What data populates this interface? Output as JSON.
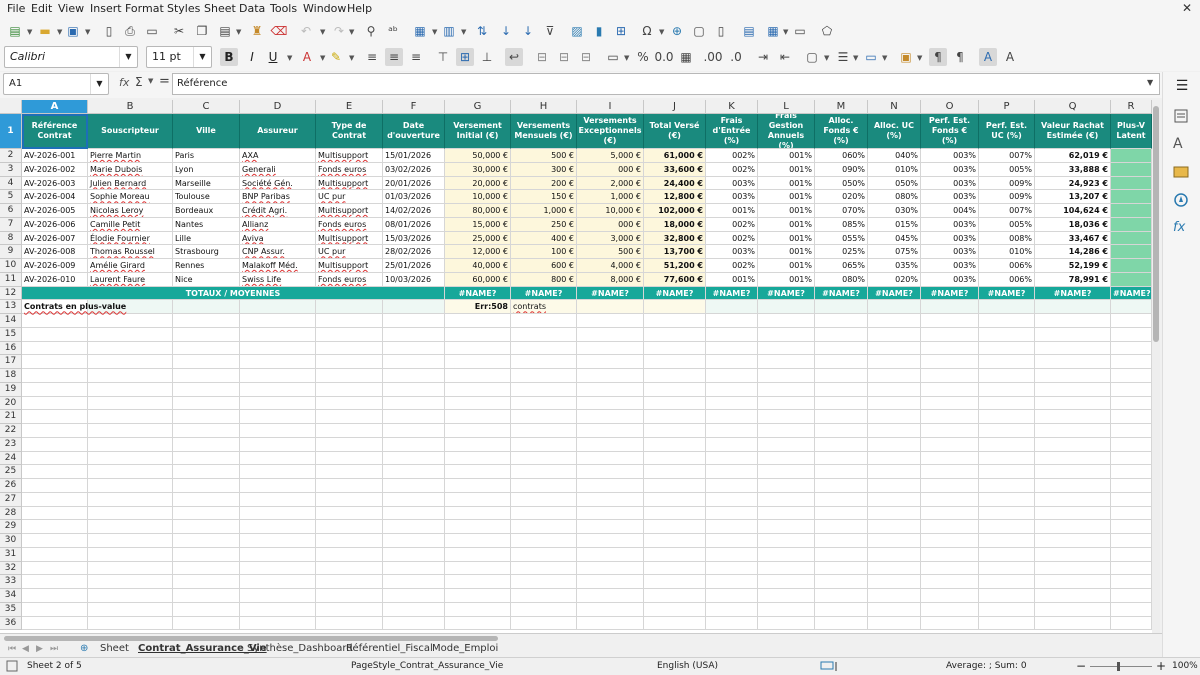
{
  "menu": [
    "File",
    "Edit",
    "View",
    "Insert",
    "Format",
    "Styles",
    "Sheet",
    "Data",
    "Tools",
    "Window",
    "Help"
  ],
  "font": {
    "name": "Calibri",
    "size": "11 pt"
  },
  "namebox": "A1",
  "formula": "Référence",
  "columns": [
    "A",
    "B",
    "C",
    "D",
    "E",
    "F",
    "G",
    "H",
    "I",
    "J",
    "K",
    "L",
    "M",
    "N",
    "O",
    "P",
    "Q",
    "R"
  ],
  "headers": [
    "Référence Contrat",
    "Souscripteur",
    "Ville",
    "Assureur",
    "Type de Contrat",
    "Date d'ouverture",
    "Versement Initial (€)",
    "Versements Mensuels (€)",
    "Versements Exceptionnels (€)",
    "Total Versé (€)",
    "Frais d'Entrée (%)",
    "Frais Gestion Annuels (%)",
    "Alloc. Fonds € (%)",
    "Alloc. UC (%)",
    "Perf. Est. Fonds € (%)",
    "Perf. Est. UC (%)",
    "Valeur Rachat Estimée (€)",
    "Plus-V Latent"
  ],
  "rows": [
    [
      "AV-2026-001",
      "Pierre Martin",
      "Paris",
      "AXA",
      "Multisupport",
      "15/01/2026",
      "50,000 €",
      "500 €",
      "5,000 €",
      "61,000 €",
      "002%",
      "001%",
      "060%",
      "040%",
      "003%",
      "007%",
      "62,019 €"
    ],
    [
      "AV-2026-002",
      "Marie Dubois",
      "Lyon",
      "Generali",
      "Fonds euros",
      "03/02/2026",
      "30,000 €",
      "300 €",
      "000 €",
      "33,600 €",
      "002%",
      "001%",
      "090%",
      "010%",
      "003%",
      "005%",
      "33,888 €"
    ],
    [
      "AV-2026-003",
      "Julien Bernard",
      "Marseille",
      "Société Gén.",
      "Multisupport",
      "20/01/2026",
      "20,000 €",
      "200 €",
      "2,000 €",
      "24,400 €",
      "003%",
      "001%",
      "050%",
      "050%",
      "003%",
      "009%",
      "24,923 €"
    ],
    [
      "AV-2026-004",
      "Sophie Moreau",
      "Toulouse",
      "BNP Paribas",
      "UC pur",
      "01/03/2026",
      "10,000 €",
      "150 €",
      "1,000 €",
      "12,800 €",
      "003%",
      "001%",
      "020%",
      "080%",
      "003%",
      "009%",
      "13,207 €"
    ],
    [
      "AV-2026-005",
      "Nicolas Leroy",
      "Bordeaux",
      "Crédit Agri.",
      "Multisupport",
      "14/02/2026",
      "80,000 €",
      "1,000 €",
      "10,000 €",
      "102,000 €",
      "001%",
      "001%",
      "070%",
      "030%",
      "004%",
      "007%",
      "104,624 €"
    ],
    [
      "AV-2026-006",
      "Camille Petit",
      "Nantes",
      "Allianz",
      "Fonds euros",
      "08/01/2026",
      "15,000 €",
      "250 €",
      "000 €",
      "18,000 €",
      "002%",
      "001%",
      "085%",
      "015%",
      "003%",
      "005%",
      "18,036 €"
    ],
    [
      "AV-2026-007",
      "Élodie Fournier",
      "Lille",
      "Aviva",
      "Multisupport",
      "15/03/2026",
      "25,000 €",
      "400 €",
      "3,000 €",
      "32,800 €",
      "002%",
      "001%",
      "055%",
      "045%",
      "003%",
      "008%",
      "33,467 €"
    ],
    [
      "AV-2026-008",
      "Thomas Roussel",
      "Strasbourg",
      "CNP Assur.",
      "UC pur",
      "28/02/2026",
      "12,000 €",
      "100 €",
      "500 €",
      "13,700 €",
      "003%",
      "001%",
      "025%",
      "075%",
      "003%",
      "010%",
      "14,286 €"
    ],
    [
      "AV-2026-009",
      "Amélie Girard",
      "Rennes",
      "Malakoff Méd.",
      "Multisupport",
      "25/01/2026",
      "40,000 €",
      "600 €",
      "4,000 €",
      "51,200 €",
      "002%",
      "001%",
      "065%",
      "035%",
      "003%",
      "006%",
      "52,199 €"
    ],
    [
      "AV-2026-010",
      "Laurent Faure",
      "Nice",
      "Swiss Life",
      "Fonds euros",
      "10/03/2026",
      "60,000 €",
      "800 €",
      "8,000 €",
      "77,600 €",
      "001%",
      "001%",
      "080%",
      "020%",
      "003%",
      "006%",
      "78,991 €"
    ]
  ],
  "totals_label": "TOTAUX / MOYENNES",
  "name_error": "#NAME?",
  "row13": {
    "label": "Contrats en plus-value",
    "err": "Err:508",
    "word": "contrats"
  },
  "row_numbers": [
    "1",
    "2",
    "3",
    "4",
    "5",
    "6",
    "7",
    "8",
    "9",
    "10",
    "11",
    "12",
    "13",
    "14",
    "15",
    "16",
    "17",
    "18",
    "19",
    "20",
    "21",
    "22",
    "23",
    "24",
    "25",
    "26",
    "27",
    "28",
    "29",
    "30",
    "31",
    "32",
    "33",
    "34",
    "35",
    "36"
  ],
  "tabs": [
    "Sheet",
    "Contrat_Assurance_Vie",
    "Synthèse_Dashboard",
    "Référentiel_Fiscal",
    "Mode_Emploi"
  ],
  "status": {
    "sheet": "Sheet 2 of 5",
    "pagestyle": "PageStyle_Contrat_Assurance_Vie",
    "lang": "English (USA)",
    "agg": "Average: ; Sum: 0",
    "zoom": "100%"
  }
}
